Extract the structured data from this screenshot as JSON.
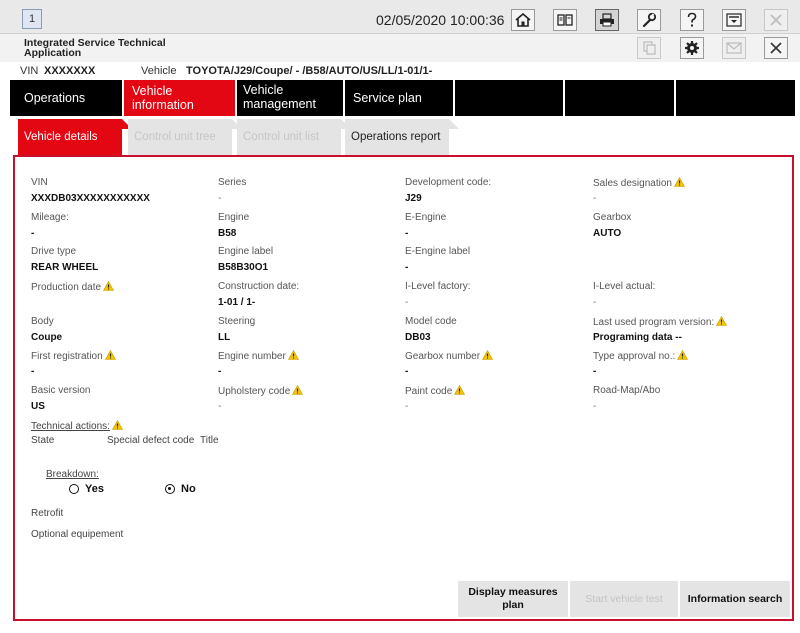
{
  "toolbar": {
    "window_number": "1",
    "datetime": "02/05/2020 10:00:36",
    "icons": [
      "home-icon",
      "compare-icon",
      "print-icon",
      "wrench-icon",
      "help-icon",
      "dropdown-menu-icon",
      "close-icon"
    ]
  },
  "titlebar": {
    "app_title": "Integrated Service Technical Application",
    "icons": [
      "copy-icon",
      "settings-icon",
      "mail-icon",
      "close-icon"
    ]
  },
  "vin_line": {
    "vin_label": "VIN",
    "vin_value": "XXXXXXX",
    "vehicle_label": "Vehicle",
    "vehicle_value": "TOYOTA/J29/Coupe/ - /B58/AUTO/US/LL/1-01/1-"
  },
  "main_nav": [
    {
      "label": "Operations",
      "active": false
    },
    {
      "label": "Vehicle information",
      "active": true
    },
    {
      "label": "Vehicle management",
      "active": false
    },
    {
      "label": "Service plan",
      "active": false
    },
    {
      "label": "",
      "active": false
    },
    {
      "label": "",
      "active": false
    },
    {
      "label": "",
      "active": false
    }
  ],
  "sub_tabs": [
    {
      "label": "Vehicle details",
      "state": "active"
    },
    {
      "label": "Control unit tree",
      "state": "disabled"
    },
    {
      "label": "Control unit list",
      "state": "disabled"
    },
    {
      "label": "Operations report",
      "state": "enabled"
    }
  ],
  "fields": {
    "vin": {
      "label": "VIN",
      "value": "XXXDB03XXXXXXXXXXX"
    },
    "series": {
      "label": "Series",
      "value": "-"
    },
    "development_code": {
      "label": "Development code:",
      "value": "J29"
    },
    "sales_designation": {
      "label": "Sales designation",
      "value": "-"
    },
    "mileage": {
      "label": "Mileage:",
      "value": "-"
    },
    "engine": {
      "label": "Engine",
      "value": "B58"
    },
    "e_engine": {
      "label": "E-Engine",
      "value": "-"
    },
    "gearbox": {
      "label": "Gearbox",
      "value": "AUTO"
    },
    "drive_type": {
      "label": "Drive type",
      "value": "REAR WHEEL"
    },
    "engine_label": {
      "label": "Engine label",
      "value": "B58B30O1"
    },
    "e_engine_label": {
      "label": "E-Engine label",
      "value": "-"
    },
    "production_date": {
      "label": "Production date",
      "value": ""
    },
    "construction_date": {
      "label": "Construction date:",
      "value": "1-01 / 1-"
    },
    "i_level_factory": {
      "label": "I-Level factory:",
      "value": "-"
    },
    "i_level_actual": {
      "label": "I-Level actual:",
      "value": "-"
    },
    "body": {
      "label": "Body",
      "value": "Coupe"
    },
    "steering": {
      "label": "Steering",
      "value": "LL"
    },
    "model_code": {
      "label": "Model code",
      "value": "DB03"
    },
    "last_program_version": {
      "label": "Last used program version:",
      "value": "Programing data --"
    },
    "first_registration": {
      "label": "First registration",
      "value": "-"
    },
    "engine_number": {
      "label": "Engine number",
      "value": "-"
    },
    "gearbox_number": {
      "label": "Gearbox number",
      "value": "-"
    },
    "type_approval_no": {
      "label": "Type approval no.:",
      "value": "-"
    },
    "basic_version": {
      "label": "Basic version",
      "value": "US"
    },
    "upholstery_code": {
      "label": "Upholstery code",
      "value": "-"
    },
    "paint_code": {
      "label": "Paint code",
      "value": "-"
    },
    "road_map_abo": {
      "label": "Road-Map/Abo",
      "value": "-"
    }
  },
  "technical_actions": {
    "label": "Technical actions:",
    "columns": [
      "State",
      "Special defect code",
      "Title"
    ]
  },
  "breakdown": {
    "label": "Breakdown:",
    "options": [
      {
        "label": "Yes",
        "selected": false
      },
      {
        "label": "No",
        "selected": true
      }
    ]
  },
  "retrofit_label": "Retrofit",
  "optional_equipment_label": "Optional equipement",
  "bottom_buttons": [
    {
      "label": "Display measures plan",
      "enabled": true
    },
    {
      "label": "Start vehicle test",
      "enabled": false
    },
    {
      "label": "Information search",
      "enabled": true
    }
  ],
  "colors": {
    "accent_red": "#e30613",
    "nav_black": "#000000",
    "warning_yellow": "#f5c400"
  }
}
